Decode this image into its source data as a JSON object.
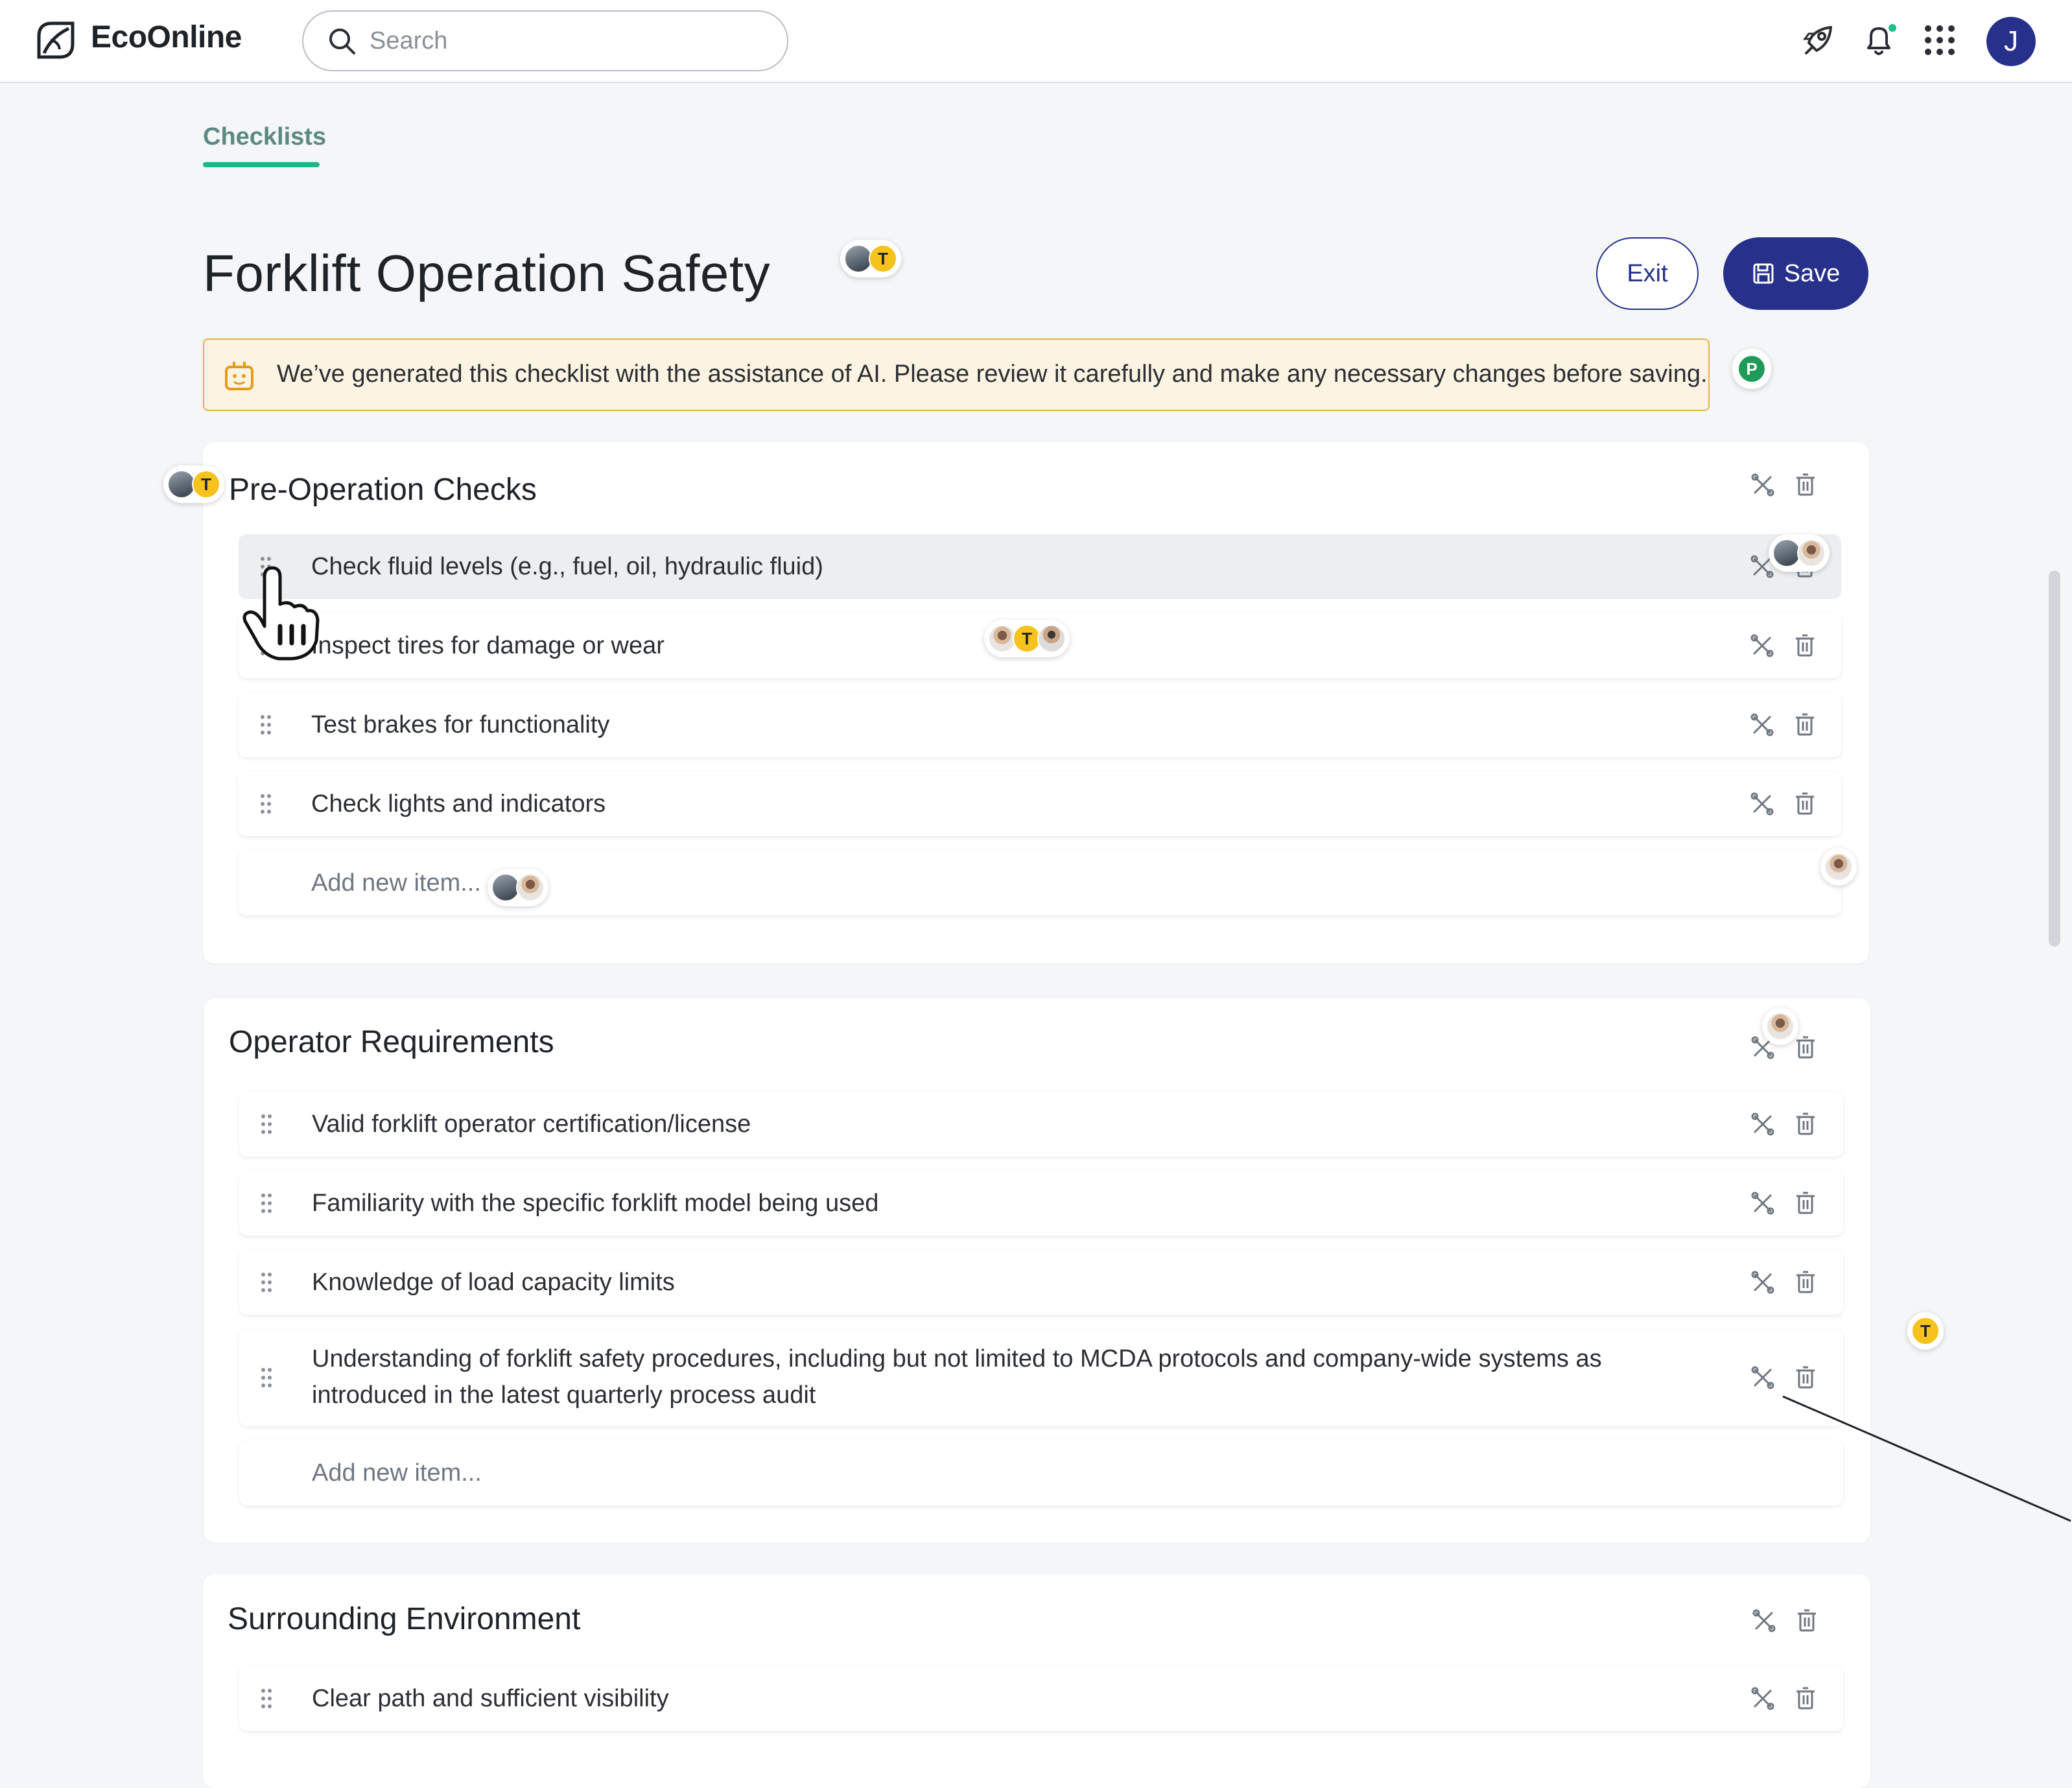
{
  "header": {
    "brand": "EcoOnline",
    "search_placeholder": "Search",
    "user_initial": "J",
    "icons": [
      "logo-icon",
      "search-icon",
      "rocket-icon",
      "bell-icon",
      "apps-grid-icon"
    ]
  },
  "tabs": [
    {
      "label": "Checklists",
      "active": true
    }
  ],
  "page": {
    "title": "Forklift Operation Safety",
    "exit_label": "Exit",
    "save_label": "Save",
    "ai_notice": "We’ve generated this checklist with the assistance of AI. Please review it carefully and make any necessary changes before saving."
  },
  "sections": [
    {
      "title": "Pre-Operation Checks",
      "items": [
        "Check fluid levels (e.g., fuel, oil, hydraulic fluid)",
        "Inspect tires for damage or wear",
        "Test brakes for functionality",
        "Check lights and indicators"
      ],
      "add_placeholder": "Add new item..."
    },
    {
      "title": "Operator Requirements",
      "items": [
        "Valid forklift operator certification/license",
        "Familiarity with the specific forklift model being used",
        "Knowledge of load capacity limits",
        "Understanding of forklift safety procedures, including but not limited to MCDA protocols and company-wide systems as introduced in the latest quarterly process audit"
      ],
      "add_placeholder": "Add new item..."
    },
    {
      "title": "Surrounding Environment",
      "items": [
        "Clear path and sufficient visibility"
      ]
    }
  ],
  "collaborators": {
    "t_initial": "T",
    "p_initial": "P"
  },
  "colors": {
    "brand_navy": "#27308a",
    "tab_accent": "#1fb38a",
    "banner_border": "#e8b04d",
    "banner_bg": "#fdf3e2",
    "notification_dot": "#1fbf8f"
  }
}
